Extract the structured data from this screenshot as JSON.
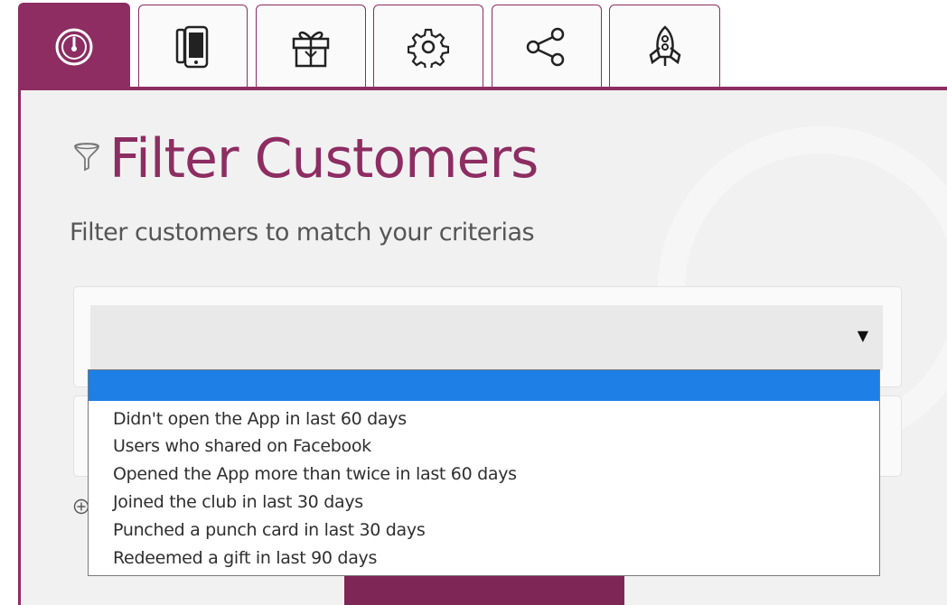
{
  "tabs": [
    {
      "name": "dashboard",
      "icon": "speedometer-icon",
      "active": true
    },
    {
      "name": "mobile",
      "icon": "mobile-phone-icon",
      "active": false
    },
    {
      "name": "gifts",
      "icon": "gift-icon",
      "active": false
    },
    {
      "name": "settings",
      "icon": "gear-icon",
      "active": false
    },
    {
      "name": "share",
      "icon": "share-icon",
      "active": false
    },
    {
      "name": "launch",
      "icon": "rocket-icon",
      "active": false
    }
  ],
  "page": {
    "title": "Filter Customers",
    "title_icon": "funnel-icon",
    "subtitle": "Filter customers to match your criterias"
  },
  "filter_select": {
    "selected_value": "",
    "options": [
      "",
      "Didn't open the App in last 60 days",
      "Users who shared on Facebook",
      "Opened the App more than twice in last 60 days",
      "Joined the club in last 30 days",
      "Punched a punch card in last 30 days",
      "Redeemed a gift in last 90 days"
    ],
    "highlighted_index": 0
  },
  "colors": {
    "accent": "#8d2d62",
    "panel_bg": "#f1f1f1",
    "highlight": "#1e7fe6"
  }
}
